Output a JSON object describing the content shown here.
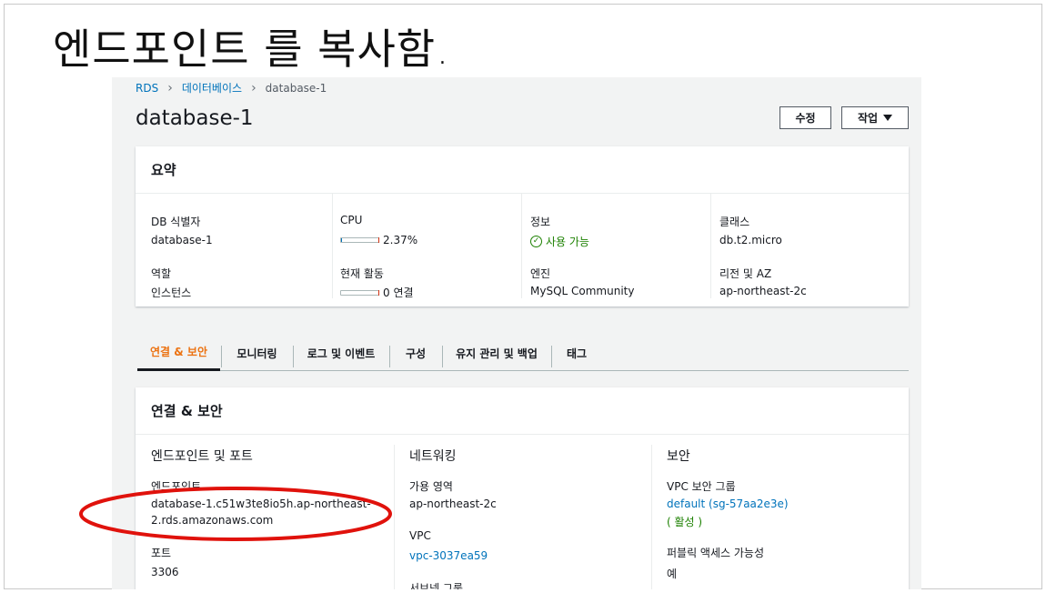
{
  "slide": {
    "title": "엔드포인트 를 복사함."
  },
  "breadcrumb": {
    "rds": "RDS",
    "databases": "데이터베이스",
    "current": "database-1"
  },
  "header": {
    "title": "database-1",
    "edit_label": "수정",
    "actions_label": "작업"
  },
  "summary": {
    "title": "요약",
    "db_id_label": "DB 식별자",
    "db_id_value": "database-1",
    "role_label": "역할",
    "role_value": "인스턴스",
    "cpu_label": "CPU",
    "cpu_value": "2.37%",
    "cpu_fraction": 0.0237,
    "activity_label": "현재 활동",
    "activity_value": "0 연결",
    "status_label": "정보",
    "status_value": "사용 가능",
    "engine_label": "엔진",
    "engine_value": "MySQL Community",
    "class_label": "클래스",
    "class_value": "db.t2.micro",
    "region_label": "리전 및 AZ",
    "region_value": "ap-northeast-2c"
  },
  "tabs": [
    {
      "label": "연결 & 보안",
      "active": true
    },
    {
      "label": "모니터링"
    },
    {
      "label": "로그 및 이벤트"
    },
    {
      "label": "구성"
    },
    {
      "label": "유지 관리 및 백업"
    },
    {
      "label": "태그"
    }
  ],
  "connectivity": {
    "title": "연결 & 보안",
    "endpoint_section": "엔드포인트 및 포트",
    "endpoint_label": "엔드포인트",
    "endpoint_line1": "database-1.c51w3te8io5h.ap-northeast-",
    "endpoint_line2": "2.rds.amazonaws.com",
    "port_label": "포트",
    "port_value": "3306",
    "network_section": "네트워킹",
    "az_label": "가용 영역",
    "az_value": "ap-northeast-2c",
    "vpc_label": "VPC",
    "vpc_value": "vpc-3037ea59",
    "subnet_label": "서브넷 그룹",
    "security_section": "보안",
    "sg_label": "VPC 보안 그룹",
    "sg_value": "default (sg-57aa2e3e)",
    "sg_status": "( 활성 )",
    "public_label": "퍼블릭 액세스 가능성",
    "public_value": "예"
  },
  "colors": {
    "accent": "#ec7211",
    "link": "#0073bb",
    "success": "#1d8102",
    "annotation": "#e0120c"
  }
}
